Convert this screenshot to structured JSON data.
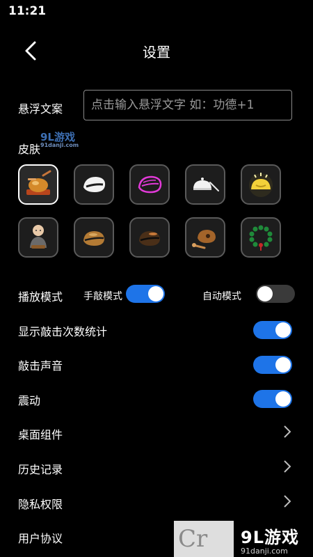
{
  "status_bar": {
    "time": "11:21"
  },
  "header": {
    "title": "设置"
  },
  "float_text": {
    "label": "悬浮文案",
    "placeholder": "点击输入悬浮文字 如：功德+1"
  },
  "skins": {
    "label": "皮肤",
    "items": [
      {
        "icon": "wooden-fish-stand-icon",
        "selected": true
      },
      {
        "icon": "white-wooden-fish-icon",
        "selected": false
      },
      {
        "icon": "neon-wooden-fish-icon",
        "selected": false
      },
      {
        "icon": "white-bowl-mallet-icon",
        "selected": false
      },
      {
        "icon": "glowing-yellow-bell-icon",
        "selected": false
      },
      {
        "icon": "little-monk-icon",
        "selected": false
      },
      {
        "icon": "bronze-wooden-fish-icon",
        "selected": false
      },
      {
        "icon": "dark-wooden-fish-icon",
        "selected": false
      },
      {
        "icon": "wooden-fish-mallet-icon",
        "selected": false
      },
      {
        "icon": "green-prayer-beads-icon",
        "selected": false
      }
    ]
  },
  "play_mode": {
    "label": "播放模式",
    "manual": {
      "label": "手敲模式",
      "on": true
    },
    "auto": {
      "label": "自动模式",
      "on": false
    }
  },
  "settings": [
    {
      "label": "显示敲击次数统计",
      "control": "toggle",
      "on": true
    },
    {
      "label": "敲击声音",
      "control": "toggle",
      "on": true
    },
    {
      "label": "震动",
      "control": "toggle",
      "on": true
    },
    {
      "label": "桌面组件",
      "control": "chevron"
    },
    {
      "label": "历史记录",
      "control": "chevron"
    },
    {
      "label": "隐私权限",
      "control": "chevron"
    },
    {
      "label": "用户协议",
      "control": "chevron"
    }
  ],
  "watermarks": {
    "mid_brand": "9L游戏",
    "mid_domain": "91danji.com",
    "corner_text": "Cr",
    "brand": "9L游戏",
    "domain": "91danji.com"
  },
  "colors": {
    "accent": "#1e74e8",
    "background": "#000000"
  }
}
